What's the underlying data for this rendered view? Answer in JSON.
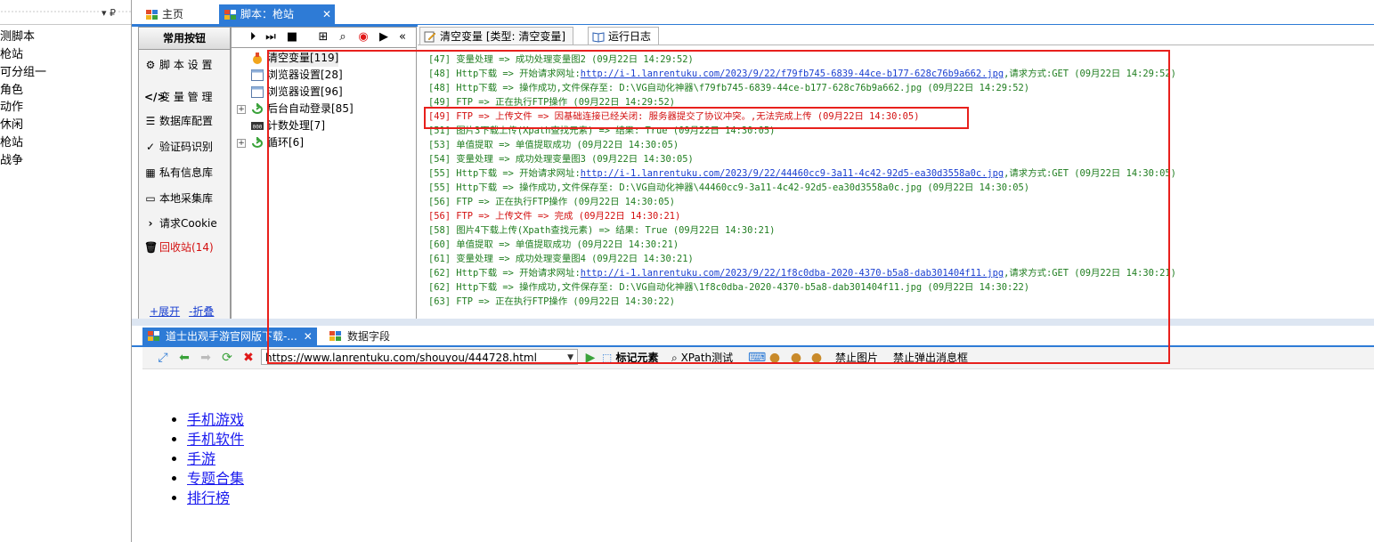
{
  "left_tree": {
    "pin": "▾ ₽",
    "items": [
      "测脚本",
      "枪站",
      "可分组一",
      "角色",
      "动作",
      "休闲",
      "枪站",
      "战争"
    ]
  },
  "top_tabs": {
    "main": "主页",
    "script": "脚本：枪站"
  },
  "common": {
    "title": "常用按钮",
    "items": [
      "脚 本 设 置",
      "变 量 管 理",
      "数据库配置",
      "验证码识别",
      "私有信息库",
      "本地采集库",
      "请求Cookie",
      "回收站(14)"
    ],
    "expand": "+展开",
    "collapse": "-折叠"
  },
  "tree_nodes": [
    "清空变量[119]",
    "浏览器设置[28]",
    "浏览器设置[96]",
    "后台自动登录[85]",
    "计数处理[7]",
    "循环[6]"
  ],
  "log_tabs": {
    "clear_var": "清空变量 [类型: 清空变量]",
    "run_log": "运行日志"
  },
  "log_lines": [
    {
      "text": "[47] 变量处理 => 成功处理变量图2 (09月22日 14:29:52)",
      "color": "green"
    },
    {
      "pre": "[48] Http下载 => 开始请求网址:",
      "url": "http://i-1.lanrentuku.com/2023/9/22/f79fb745-6839-44ce-b177-628c76b9a662.jpg",
      "post": ",请求方式:GET (09月22日 14:29:52)",
      "color": "green"
    },
    {
      "text": "[48] Http下载 => 操作成功,文件保存至: D:\\VG自动化神器\\f79fb745-6839-44ce-b177-628c76b9a662.jpg (09月22日 14:29:52)",
      "color": "green"
    },
    {
      "text": "[49] FTP => 正在执行FTP操作 (09月22日 14:29:52)",
      "color": "green"
    },
    {
      "text": "[49] FTP => 上传文件 => 因基础连接已经关闭: 服务器提交了协议冲突。,无法完成上传 (09月22日 14:30:05)",
      "color": "red"
    },
    {
      "text": "[51] 图片3下载上传(Xpath查找元素) => 结果: True (09月22日 14:30:05)",
      "color": "green"
    },
    {
      "text": "[53] 单值提取 => 单值提取成功 (09月22日 14:30:05)",
      "color": "green"
    },
    {
      "text": "[54] 变量处理 => 成功处理变量图3 (09月22日 14:30:05)",
      "color": "green"
    },
    {
      "pre": "[55] Http下载 => 开始请求网址:",
      "url": "http://i-1.lanrentuku.com/2023/9/22/44460cc9-3a11-4c42-92d5-ea30d3558a0c.jpg",
      "post": ",请求方式:GET (09月22日 14:30:05)",
      "color": "green"
    },
    {
      "text": "[55] Http下载 => 操作成功,文件保存至: D:\\VG自动化神器\\44460cc9-3a11-4c42-92d5-ea30d3558a0c.jpg (09月22日 14:30:05)",
      "color": "green"
    },
    {
      "text": "[56] FTP => 正在执行FTP操作 (09月22日 14:30:05)",
      "color": "green"
    },
    {
      "text": "[56] FTP => 上传文件 => 完成 (09月22日 14:30:21)",
      "color": "red"
    },
    {
      "text": "[58] 图片4下载上传(Xpath查找元素) => 结果: True (09月22日 14:30:21)",
      "color": "green"
    },
    {
      "text": "[60] 单值提取 => 单值提取成功 (09月22日 14:30:21)",
      "color": "green"
    },
    {
      "text": "[61] 变量处理 => 成功处理变量图4 (09月22日 14:30:21)",
      "color": "green"
    },
    {
      "pre": "[62] Http下载 => 开始请求网址:",
      "url": "http://i-1.lanrentuku.com/2023/9/22/1f8c0dba-2020-4370-b5a8-dab301404f11.jpg",
      "post": ",请求方式:GET (09月22日 14:30:21)",
      "color": "green"
    },
    {
      "text": "[62] Http下载 => 操作成功,文件保存至: D:\\VG自动化神器\\1f8c0dba-2020-4370-b5a8-dab301404f11.jpg (09月22日 14:30:22)",
      "color": "green"
    },
    {
      "text": "[63] FTP => 正在执行FTP操作 (09月22日 14:30:22)",
      "color": "green"
    }
  ],
  "bottom_tabs": {
    "page": "道士出观手游官网版下载-...",
    "fields": "数据字段"
  },
  "browser": {
    "url": "https://www.lanrentuku.com/shouyou/444728.html",
    "mark": "标记元素",
    "xpath_test": "XPath测试",
    "block_images": "禁止图片",
    "block_popups": "禁止弹出消息框"
  },
  "page_links": [
    "手机游戏",
    "手机软件",
    "手游",
    "专题合集",
    "排行榜"
  ],
  "colors": {
    "accent": "#2e7bd6",
    "highlight": "#e8201c",
    "log_green": "#1f7d1f",
    "log_red": "#d31010"
  }
}
